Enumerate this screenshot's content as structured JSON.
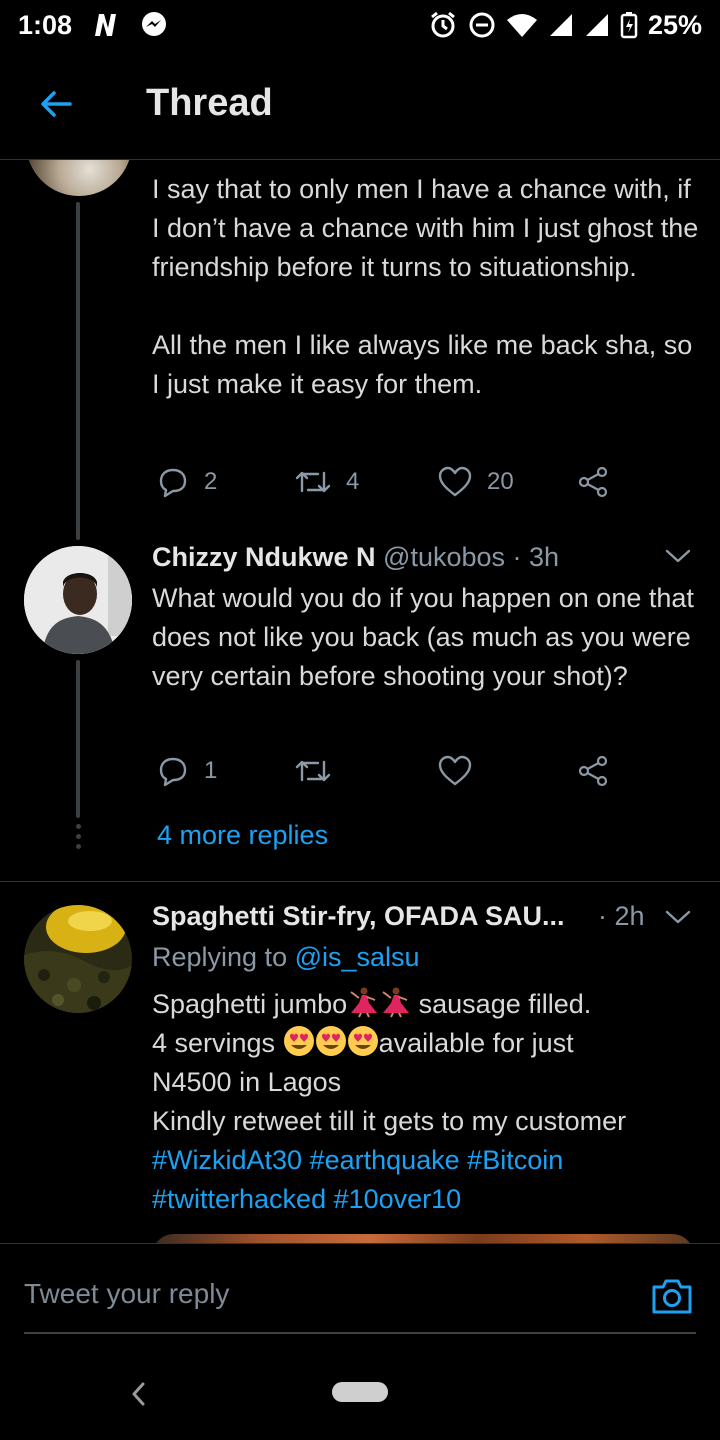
{
  "status": {
    "time": "1:08",
    "battery": "25%"
  },
  "header": {
    "title": "Thread"
  },
  "tweet1": {
    "paragraph1": "I say that to only men I have a chance with, if I don’t have a chance with him I just ghost the friendship before it turns to situationship.",
    "paragraph2": "All the men I like always like me back sha, so I just make it easy for them.",
    "replies": "2",
    "retweets": "4",
    "likes": "20"
  },
  "tweet2": {
    "name": "Chizzy Ndukwe N",
    "handle": "@tukobos",
    "time": "· 3h",
    "text": "What would you do if you happen on one that does not like you back (as much as you were very certain before shooting your shot)?",
    "replies": "1"
  },
  "more_replies": "4 more replies",
  "tweet3": {
    "name": "Spaghetti Stir-fry, OFADA SAU...",
    "time": "· 2h",
    "replying_prefix": "Replying to ",
    "replying_handle": "@is_salsu",
    "line1_a": "Spaghetti jumbo",
    "line1_b": " sausage filled.",
    "line2_a": "4 servings ",
    "line2_b": "available for just",
    "line3": "N4500 in Lagos",
    "line4": "Kindly retweet till it gets to my customer",
    "hashtags_line1": "#WizkidAt30 #earthquake #Bitcoin",
    "hashtags_line2": "#twitterhacked #10over10"
  },
  "reply_box": {
    "placeholder": "Tweet your reply"
  },
  "colors": {
    "accent": "#1da1f2",
    "background": "#000000",
    "muted": "#8b98a5"
  },
  "icons": [
    "back-arrow-icon",
    "reply-icon",
    "retweet-icon",
    "like-icon",
    "share-icon",
    "chevron-down-icon",
    "camera-icon"
  ]
}
